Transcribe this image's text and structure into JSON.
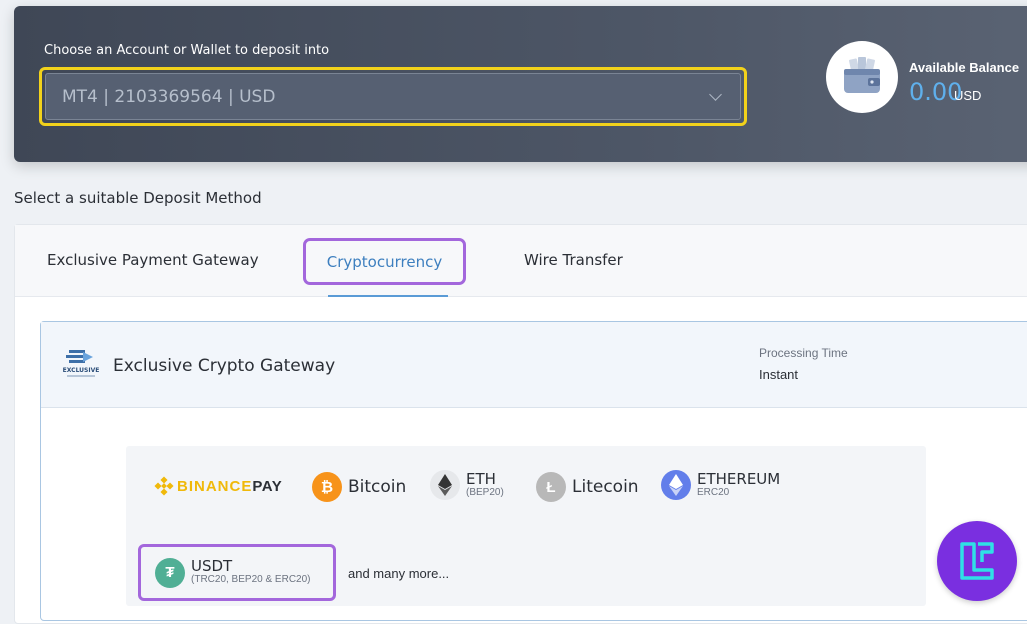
{
  "account": {
    "label": "Choose an Account or Wallet to deposit into",
    "selected": "MT4 | 2103369564 | USD"
  },
  "balance": {
    "label": "Available Balance",
    "value": "0.00",
    "currency": "USD"
  },
  "deposit": {
    "section_title": "Select a suitable Deposit Method",
    "tabs": [
      {
        "label": "Exclusive Payment Gateway"
      },
      {
        "label": "Cryptocurrency"
      },
      {
        "label": "Wire Transfer"
      }
    ],
    "active_tab": "Cryptocurrency"
  },
  "gateway": {
    "logo_text": "EXCLUSIVE",
    "title": "Exclusive Crypto Gateway",
    "processing_label": "Processing Time",
    "processing_value": "Instant"
  },
  "coins": {
    "binance": {
      "word": "BINANCE",
      "suffix": "PAY"
    },
    "bitcoin": {
      "name": "Bitcoin"
    },
    "eth": {
      "name": "ETH",
      "sub": "(BEP20)"
    },
    "litecoin": {
      "name": "Litecoin"
    },
    "ethereum": {
      "name": "ETHEREUM",
      "sub": "ERC20"
    },
    "usdt": {
      "name": "USDT",
      "sub": "(TRC20, BEP20 & ERC20)"
    },
    "more": "and many more..."
  },
  "colors": {
    "highlight_yellow": "#f2d21b",
    "highlight_purple": "#a367dc",
    "accent_blue": "#5fb0ec",
    "bitcoin": "#f7931a",
    "tether": "#50af95",
    "binance": "#f0b90b",
    "brand_badge": "#7a2fe0"
  }
}
